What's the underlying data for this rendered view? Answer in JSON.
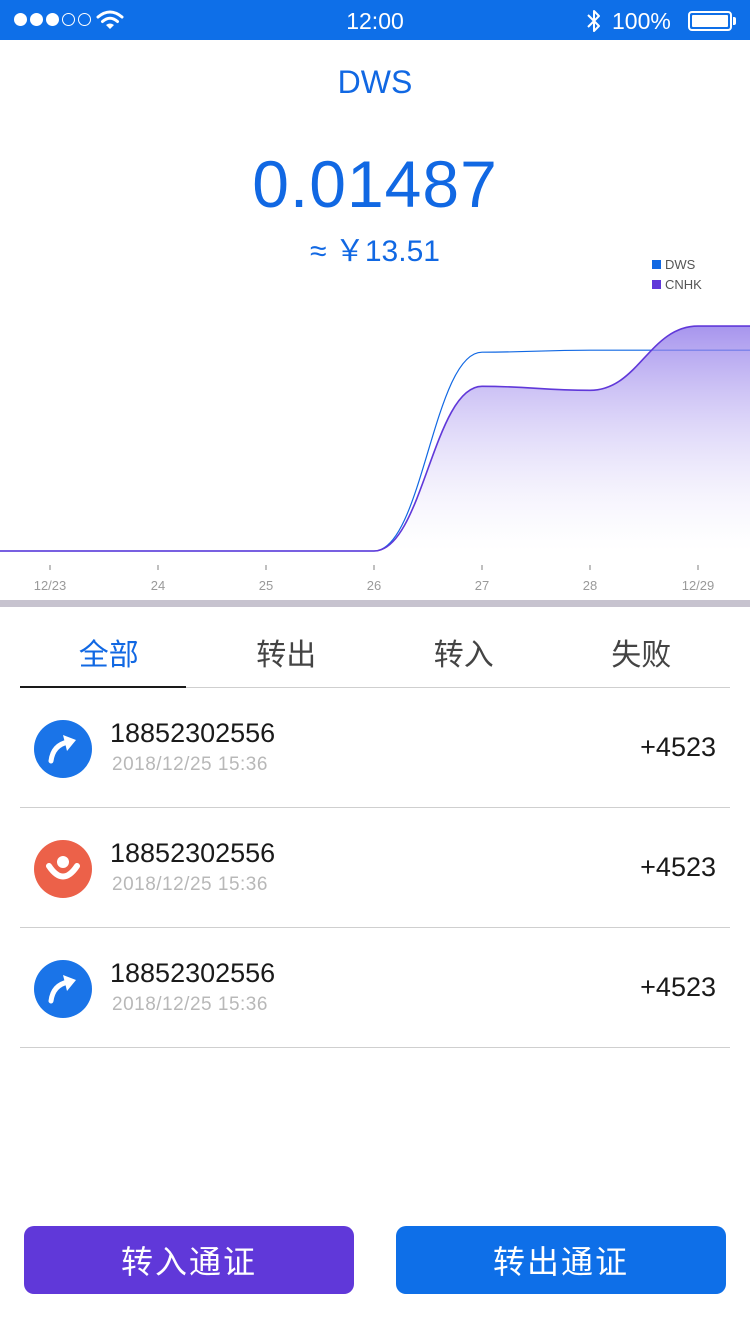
{
  "status_bar": {
    "time": "12:00",
    "battery_percent": "100%",
    "signal_bars_filled": 3,
    "signal_bars_total": 5,
    "icons": [
      "signal-dots-icon",
      "wifi-icon",
      "bluetooth-icon",
      "battery-icon"
    ]
  },
  "header": {
    "token": "DWS",
    "balance": "0.01487",
    "fiat_value": "≈  ￥13.51"
  },
  "chart_data": {
    "type": "area",
    "categories": [
      "12/23",
      "24",
      "25",
      "26",
      "27",
      "28",
      "12/29"
    ],
    "legend": "top-right",
    "series": [
      {
        "name": "DWS",
        "color": "#1168e3",
        "values": [
          0,
          0,
          0,
          0,
          0.99,
          1.0,
          1.0
        ]
      },
      {
        "name": "CNHK",
        "color": "#6038d9",
        "values": [
          0,
          0,
          0,
          0,
          0.82,
          0.8,
          1.12
        ]
      }
    ],
    "ylim": [
      0,
      1.2
    ],
    "grid": false
  },
  "tabs": [
    {
      "label": "全部",
      "active": true
    },
    {
      "label": "转出",
      "active": false
    },
    {
      "label": "转入",
      "active": false
    },
    {
      "label": "失败",
      "active": false
    }
  ],
  "transactions": [
    {
      "account": "18852302556",
      "time": "2018/12/25   15:36",
      "amount": "+4523",
      "icon": "send-arrow-icon",
      "color": "#1a74e8"
    },
    {
      "account": "18852302556",
      "time": "2018/12/25   15:36",
      "amount": "+4523",
      "icon": "receive-face-icon",
      "color": "#ec6149"
    },
    {
      "account": "18852302556",
      "time": "2018/12/25   15:36",
      "amount": "+4523",
      "icon": "send-arrow-icon",
      "color": "#1a74e8"
    }
  ],
  "actions": {
    "transfer_in": "转入通证",
    "transfer_out": "转出通证"
  },
  "colors": {
    "primary": "#0e6fe8",
    "accent_purple": "#6038d9",
    "receive_red": "#ec6149"
  }
}
